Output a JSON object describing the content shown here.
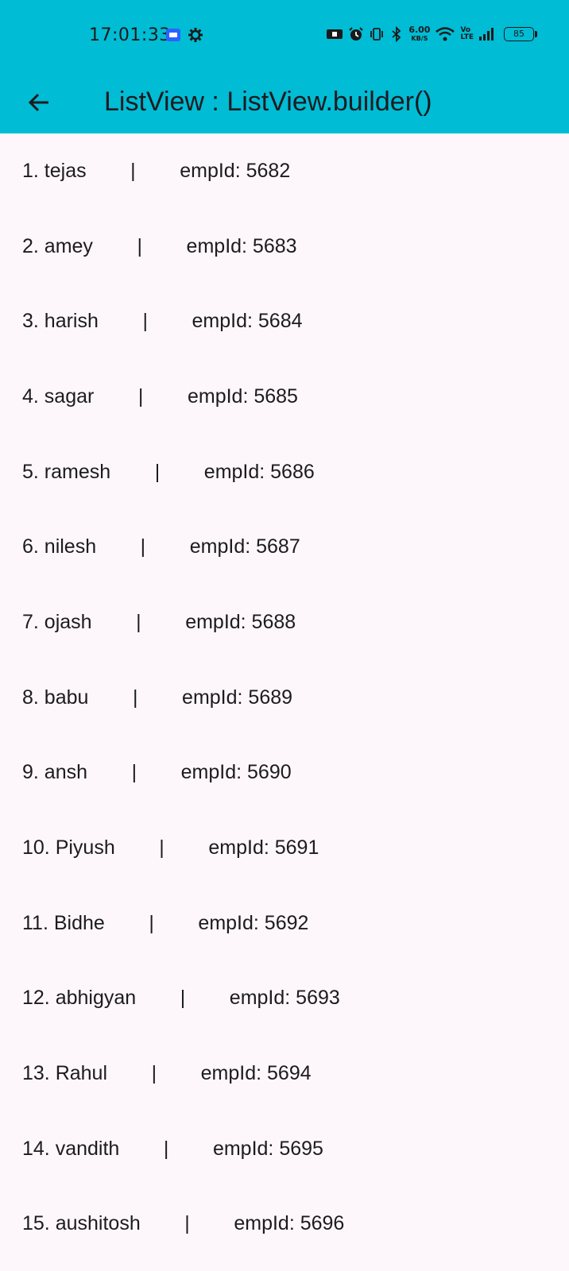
{
  "status_bar": {
    "time": "17:01:33",
    "net_speed_value": "6.00",
    "net_speed_unit": "KB/S",
    "volte_top": "Vo",
    "volte_bottom": "LTE",
    "battery": "85",
    "icons": [
      "media-icon",
      "settings-gear-icon",
      "nfc-icon",
      "alarm-icon",
      "vibrate-icon",
      "bluetooth-icon",
      "wifi-icon",
      "signal-icon",
      "battery-icon"
    ]
  },
  "app_bar": {
    "title": "ListView : ListView.builder()",
    "back_icon": "arrow-back-icon",
    "background": "#00bcd4"
  },
  "items": [
    {
      "index": 1,
      "name": "tejas",
      "empId": 5682
    },
    {
      "index": 2,
      "name": "amey",
      "empId": 5683
    },
    {
      "index": 3,
      "name": "harish",
      "empId": 5684
    },
    {
      "index": 4,
      "name": "sagar",
      "empId": 5685
    },
    {
      "index": 5,
      "name": "ramesh",
      "empId": 5686
    },
    {
      "index": 6,
      "name": "nilesh",
      "empId": 5687
    },
    {
      "index": 7,
      "name": "ojash",
      "empId": 5688
    },
    {
      "index": 8,
      "name": "babu",
      "empId": 5689
    },
    {
      "index": 9,
      "name": "ansh",
      "empId": 5690
    },
    {
      "index": 10,
      "name": "Piyush",
      "empId": 5691
    },
    {
      "index": 11,
      "name": "Bidhe",
      "empId": 5692
    },
    {
      "index": 12,
      "name": "abhigyan",
      "empId": 5693
    },
    {
      "index": 13,
      "name": "Rahul",
      "empId": 5694
    },
    {
      "index": 14,
      "name": "vandith",
      "empId": 5695
    },
    {
      "index": 15,
      "name": "aushitosh",
      "empId": 5696
    }
  ]
}
